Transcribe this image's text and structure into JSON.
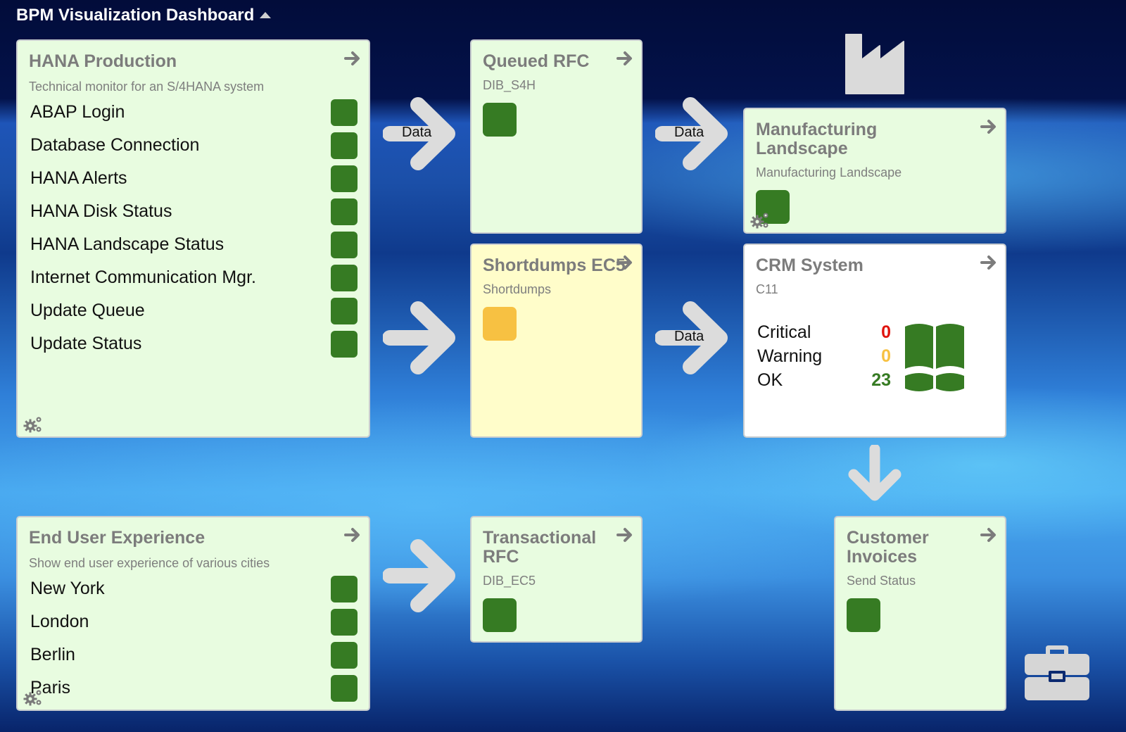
{
  "header": {
    "title": "BPM Visualization Dashboard",
    "collapse_icon": "caret-up-icon"
  },
  "colors": {
    "ok": "#367b23",
    "warning": "#f7c142",
    "critical": "#e0140e",
    "card_green": "#e8fce0",
    "card_yellow": "#fffdca",
    "card_white": "#ffffff",
    "connector": "#dcdcdc"
  },
  "cards": {
    "hana": {
      "title": "HANA Production",
      "subtitle": "Technical monitor for an S/4HANA system",
      "items": [
        {
          "label": "ABAP Login",
          "status": "ok"
        },
        {
          "label": "Database Connection",
          "status": "ok"
        },
        {
          "label": "HANA Alerts",
          "status": "ok"
        },
        {
          "label": "HANA Disk Status",
          "status": "ok"
        },
        {
          "label": "HANA Landscape Status",
          "status": "ok"
        },
        {
          "label": "Internet Communication Mgr.",
          "status": "ok"
        },
        {
          "label": "Update Queue",
          "status": "ok"
        },
        {
          "label": "Update Status",
          "status": "ok"
        }
      ]
    },
    "queued_rfc": {
      "title": "Queued RFC",
      "subtitle": "DIB_S4H",
      "status": "ok"
    },
    "manufacturing": {
      "title": "Manufacturing Landscape",
      "subtitle": "Manufacturing Landscape",
      "status": "ok"
    },
    "shortdumps": {
      "title": "Shortdumps EC5",
      "subtitle": "Shortdumps",
      "status": "warning"
    },
    "crm": {
      "title": "CRM System",
      "subtitle": "C11",
      "counts": [
        {
          "label": "Critical",
          "value": "0",
          "color": "#e0140e"
        },
        {
          "label": "Warning",
          "value": "0",
          "color": "#f7c142"
        },
        {
          "label": "OK",
          "value": "23",
          "color": "#367b23"
        }
      ],
      "icon": "database-cluster-icon"
    },
    "end_user": {
      "title": "End User Experience",
      "subtitle": "Show end user experience of various cities",
      "items": [
        {
          "label": "New York",
          "status": "ok"
        },
        {
          "label": "London",
          "status": "ok"
        },
        {
          "label": "Berlin",
          "status": "ok"
        },
        {
          "label": "Paris",
          "status": "ok"
        }
      ]
    },
    "transactional_rfc": {
      "title": "Transactional RFC",
      "subtitle": "DIB_EC5",
      "status": "ok"
    },
    "customer_invoices": {
      "title": "Customer Invoices",
      "subtitle": "Send Status",
      "status": "ok"
    }
  },
  "connectors": {
    "hana_to_qrfc": "Data",
    "qrfc_to_manufacturing": "Data",
    "shortdumps_to_crm": "Data"
  },
  "decorations": {
    "factory": "factory-icon",
    "briefcase": "briefcase-icon"
  }
}
